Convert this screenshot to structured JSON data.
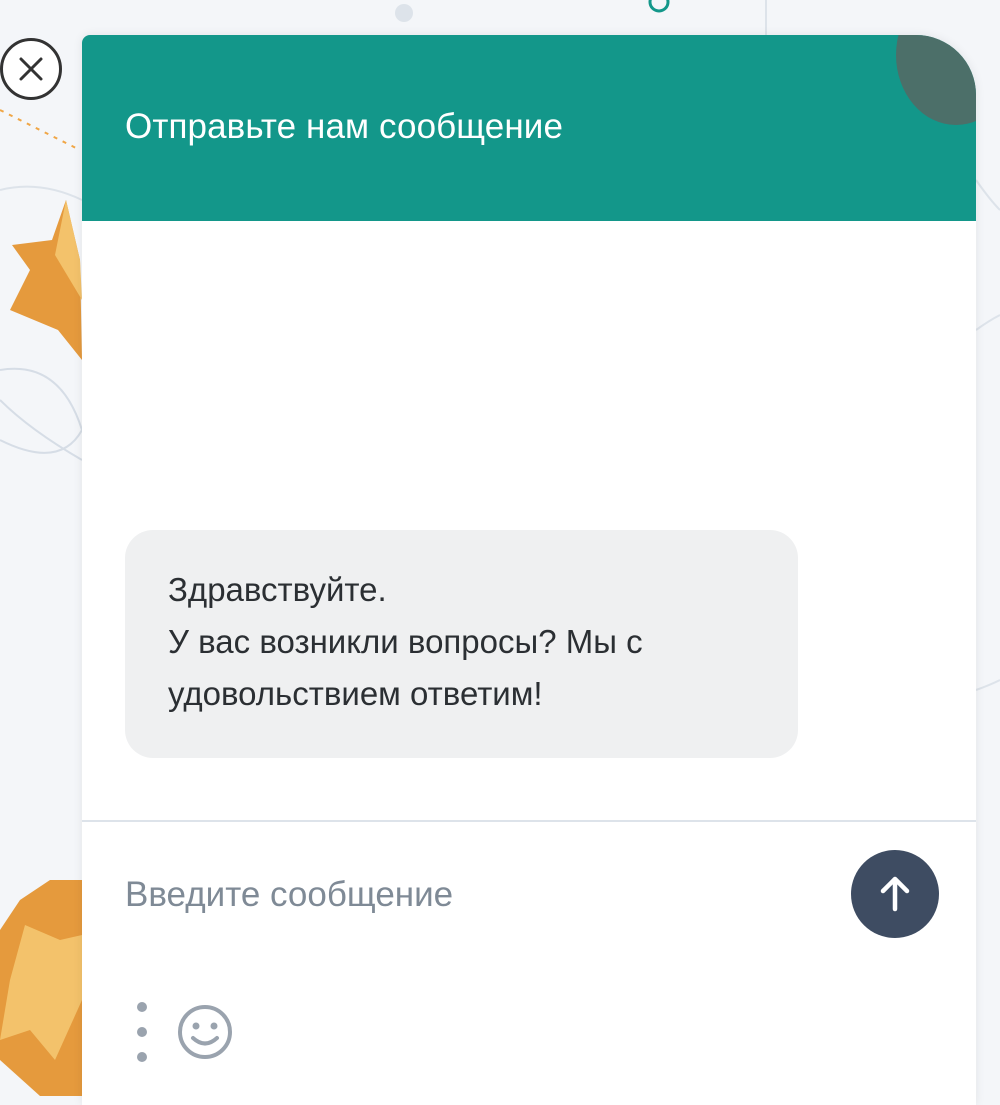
{
  "widget": {
    "title": "Отправьте нам сообщение",
    "header_color": "#13978a"
  },
  "messages": [
    {
      "sender": "operator",
      "lines": [
        "Здравствуйте.",
        "У вас возникли вопросы? Мы с",
        "удовольствием ответим!"
      ]
    }
  ],
  "composer": {
    "placeholder": "Введите сообщение",
    "value": "",
    "send_icon": "arrow-up-icon",
    "send_color": "#3e4c62",
    "more_icon": "vertical-dots-icon",
    "emoji_icon": "smiley-icon"
  },
  "close_icon": "close-icon"
}
